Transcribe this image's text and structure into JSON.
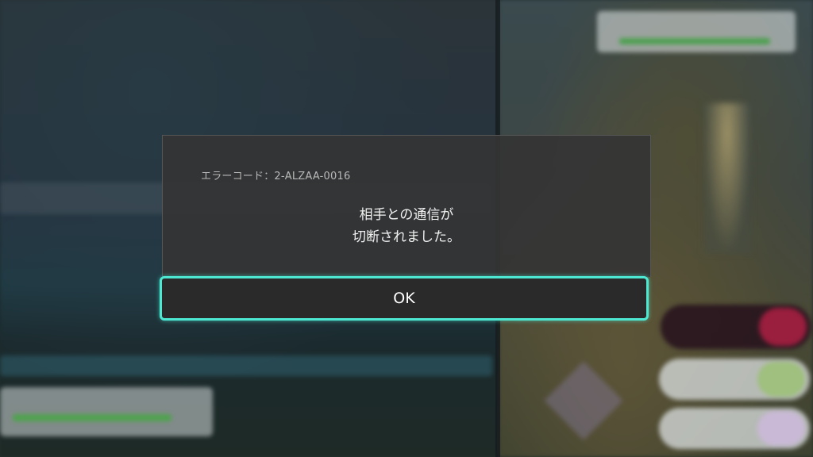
{
  "dialog": {
    "error_code": "エラーコード：2-ALZAA-0016",
    "message_line1": "相手との通信が",
    "message_line2": "切断されました。",
    "ok_label": "OK"
  },
  "colors": {
    "accent_focus": "#4de8d2",
    "dialog_bg": "#343434",
    "button_bg": "#2a2a2a"
  }
}
